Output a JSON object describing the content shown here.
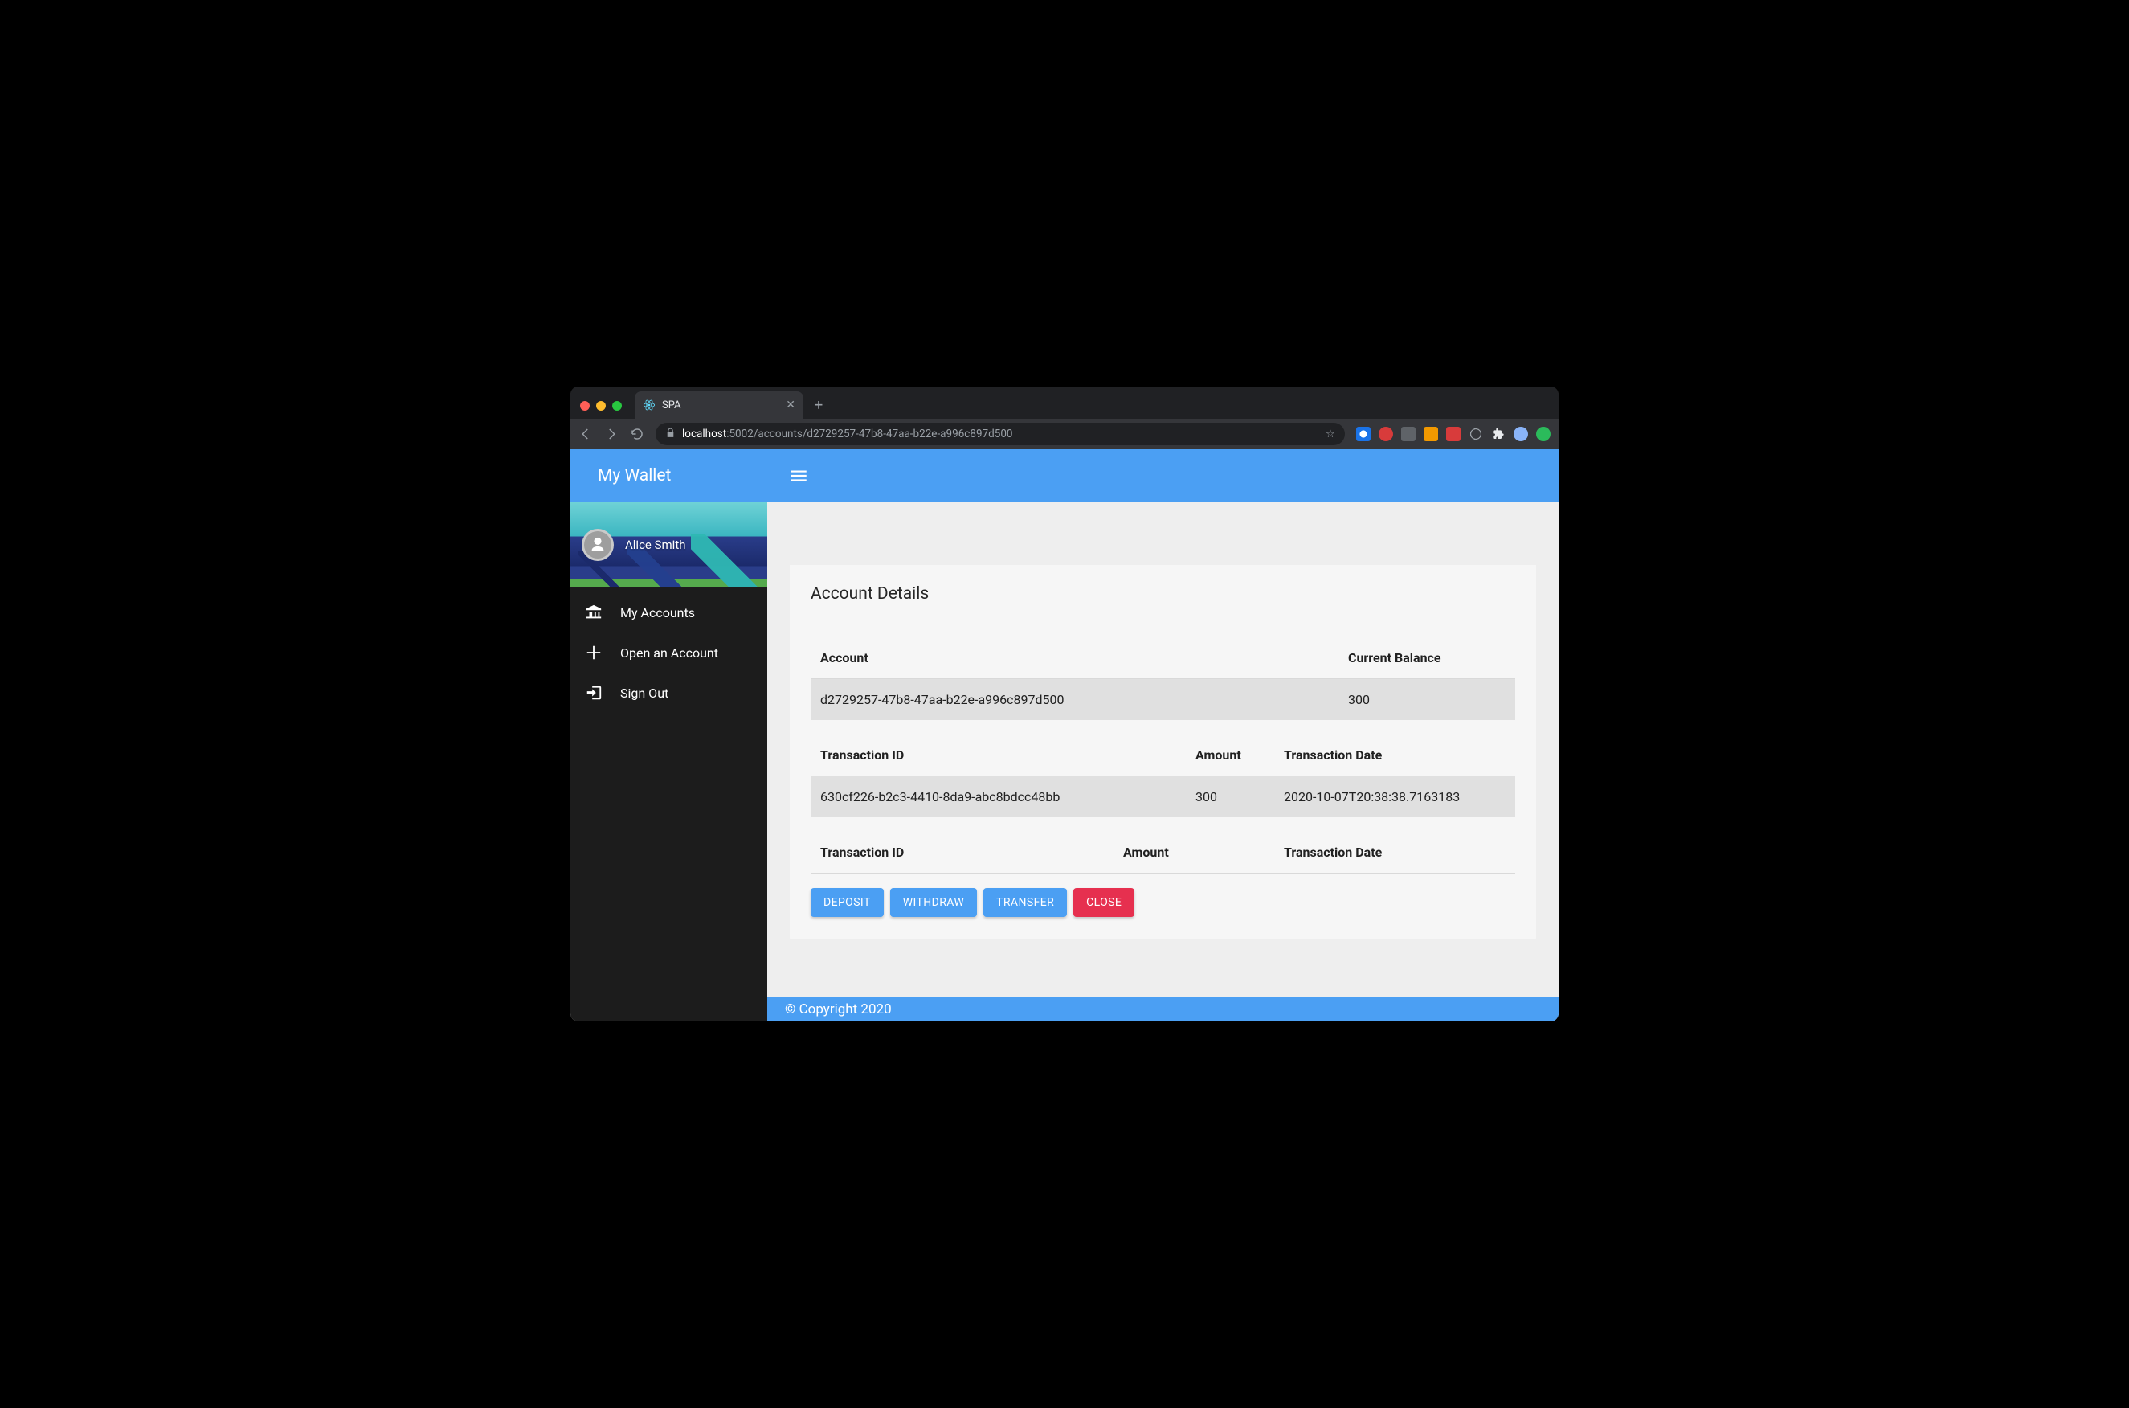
{
  "browser": {
    "tab_title": "SPA",
    "url_host": "localhost",
    "url_port_path": ":5002/accounts/d2729257-47b8-47aa-b22e-a996c897d500"
  },
  "sidebar": {
    "brand": "My Wallet",
    "user_name": "Alice Smith",
    "items": [
      {
        "icon": "bank-icon",
        "label": "My Accounts"
      },
      {
        "icon": "plus-icon",
        "label": "Open an Account"
      },
      {
        "icon": "signout-icon",
        "label": "Sign Out"
      }
    ]
  },
  "page": {
    "title": "Account Details",
    "account_table": {
      "headers": [
        "Account",
        "Current Balance"
      ],
      "rows": [
        {
          "account": "d2729257-47b8-47aa-b22e-a996c897d500",
          "balance": "300"
        }
      ]
    },
    "tx_table_1": {
      "headers": [
        "Transaction ID",
        "Amount",
        "Transaction Date"
      ],
      "rows": [
        {
          "id": "630cf226-b2c3-4410-8da9-abc8bdcc48bb",
          "amount": "300",
          "date": "2020-10-07T20:38:38.7163183"
        }
      ]
    },
    "tx_table_2": {
      "headers": [
        "Transaction ID",
        "Amount",
        "Transaction Date"
      ]
    },
    "actions": {
      "deposit": "DEPOSIT",
      "withdraw": "WITHDRAW",
      "transfer": "TRANSFER",
      "close": "CLOSE"
    }
  },
  "footer": "© Copyright 2020"
}
